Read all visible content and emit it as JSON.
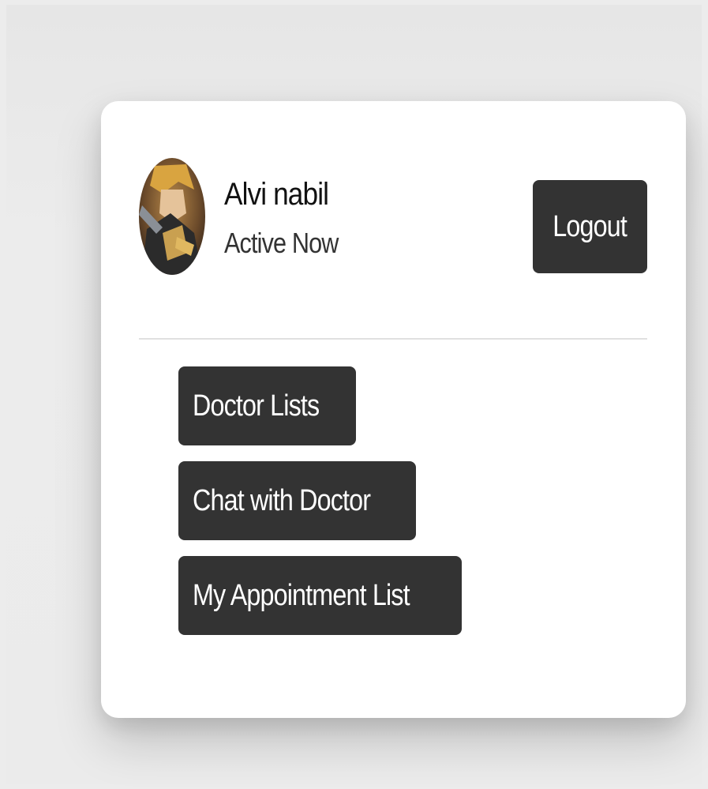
{
  "user": {
    "name": "Alvi nabil",
    "status": "Active Now"
  },
  "header": {
    "logout_label": "Logout"
  },
  "menu": {
    "items": [
      {
        "label": "Doctor Lists"
      },
      {
        "label": "Chat with Doctor"
      },
      {
        "label": "My Appointment List"
      }
    ]
  },
  "colors": {
    "button_bg": "#333333",
    "button_text": "#ffffff",
    "card_bg": "#ffffff",
    "page_bg": "#ececec"
  }
}
